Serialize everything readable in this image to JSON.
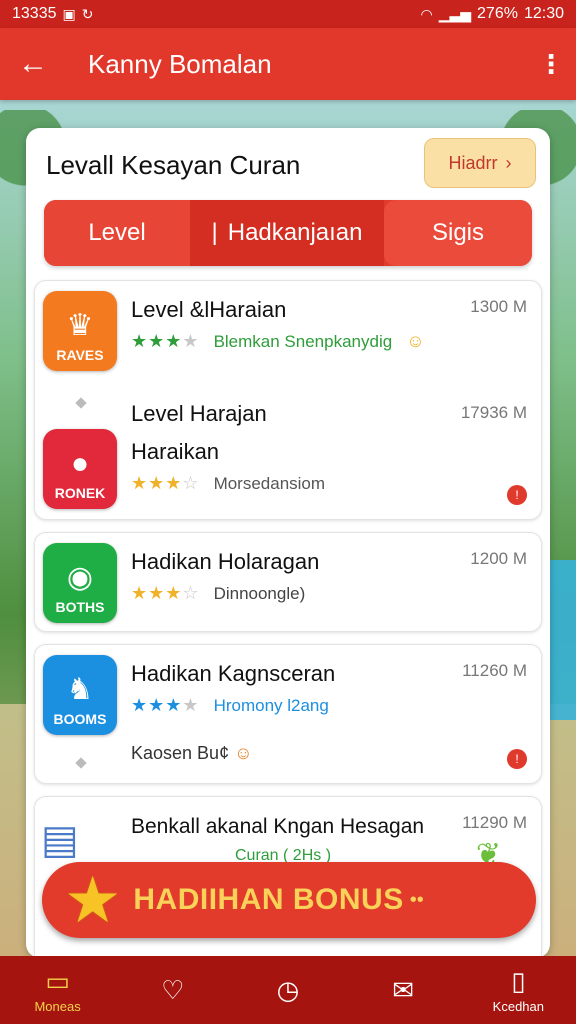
{
  "status_bar": {
    "time_left": "13335",
    "right_time": "12:30",
    "battery": "276%"
  },
  "app_bar": {
    "title": "Kanny Bomalan"
  },
  "card": {
    "heading": "Levall Kesayan Curan",
    "filter_label": "Hiadrr",
    "tabs": [
      {
        "label": "Level"
      },
      {
        "label": "Hadkanjaıan"
      },
      {
        "label": "Sigis"
      }
    ]
  },
  "items": [
    {
      "title": "Level &lHaraian",
      "size": "1300 M",
      "rating_text": "Blemkan Snenpkanydig",
      "rating_stars": 3,
      "icon_label": "RAVES",
      "icon_color": "#f47a1f",
      "rating_color": "#2e9d3a"
    },
    {
      "title": "Level Harajan",
      "title_2": "Haraikan",
      "size": "17936 M",
      "rating_text": "Morsedansiom",
      "rating_stars": 3,
      "icon_label": "RONEK",
      "icon_color": "#e2293b",
      "rating_color": "#f0b22a"
    },
    {
      "title": "Hadikan Holaragan",
      "size": "1200 M",
      "rating_text": "Dinnoongle)",
      "rating_stars": 3,
      "icon_label": "BOTHS",
      "icon_color": "#1fae45",
      "rating_color": "#f0b22a"
    },
    {
      "title": "Hadikan Kagnsceran",
      "size": "11260 M",
      "rating_text": "Hromony l2ang",
      "rating_stars": 3,
      "icon_label": "BOOMS",
      "icon_color": "#1b8fe0",
      "rating_color": "#1b8fe0",
      "footer_text": "Kaosen Bu¢"
    },
    {
      "title": "Benkall akanal Kngan Hesagan",
      "size": "11290 M",
      "rating_text": "Curan ( 2Hs )"
    }
  ],
  "bonus": {
    "label": "HADIIHAN BONUS"
  },
  "bottom_nav": [
    {
      "label": "Moneas",
      "icon": "folder-icon"
    },
    {
      "label": "",
      "icon": "heart-icon"
    },
    {
      "label": "",
      "icon": "play-icon"
    },
    {
      "label": "",
      "icon": "share-icon"
    },
    {
      "label": "Kcedhan",
      "icon": "document-icon"
    }
  ]
}
